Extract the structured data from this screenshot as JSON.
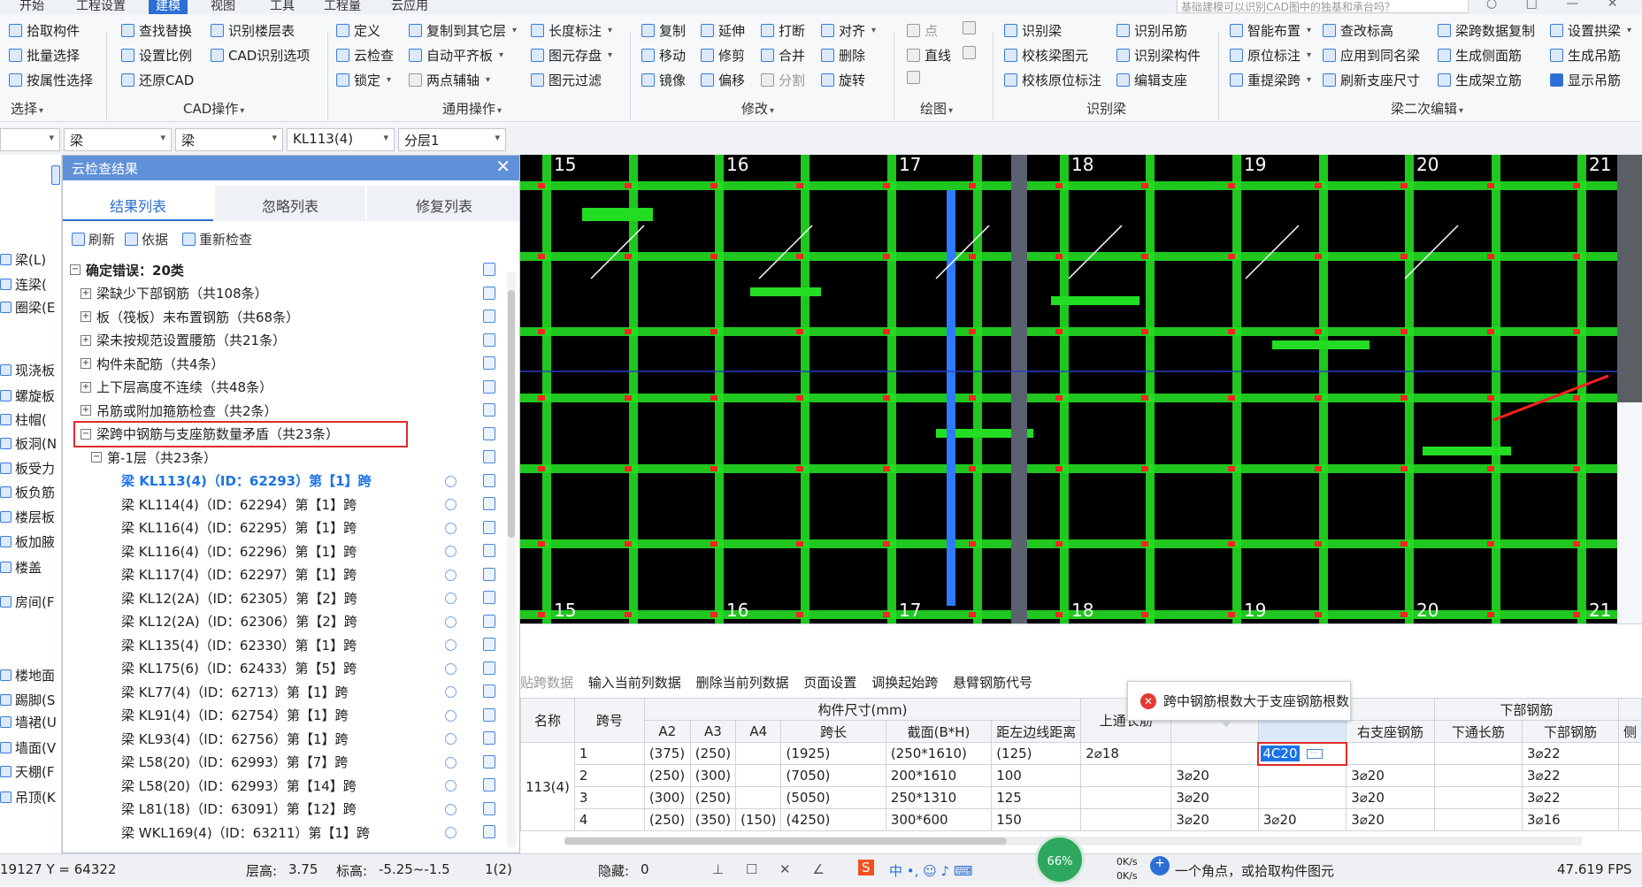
{
  "menubar": {
    "items": [
      "开始",
      "工程设置",
      "建模",
      "视图",
      "工具",
      "工程量",
      "云应用"
    ],
    "active_index": 2,
    "search_placeholder": "基础建模可以识别CAD图中的独基和承台吗？"
  },
  "ribbon": {
    "select": {
      "items": [
        "拾取构件",
        "批量选择",
        "按属性选择"
      ],
      "group": "选择"
    },
    "cad_ops": {
      "items": [
        "查找替换",
        "设置比例",
        "还原CAD",
        "识别楼层表",
        "CAD识别选项"
      ],
      "group": "CAD操作"
    },
    "common": {
      "items": [
        "定义",
        "云检查",
        "锁定",
        "复制到其它层",
        "自动平齐板",
        "两点辅轴",
        "长度标注",
        "图元存盘",
        "图元过滤"
      ],
      "group": "通用操作"
    },
    "modify": {
      "items": [
        "复制",
        "移动",
        "镜像",
        "延伸",
        "修剪",
        "偏移",
        "打断",
        "合并",
        "分割",
        "对齐",
        "删除",
        "旋转"
      ],
      "group": "修改"
    },
    "draw": {
      "items": [
        "点",
        "直线"
      ],
      "group": "绘图"
    },
    "identify_beam": {
      "items": [
        "识别梁",
        "校核梁图元",
        "校核原位标注",
        "识别吊筋",
        "识别梁构件",
        "编辑支座"
      ],
      "group": "识别梁"
    },
    "beam_edit": {
      "items": [
        "智能布置",
        "原位标注",
        "重提梁跨",
        "查改标高",
        "应用到同名梁",
        "刷新支座尺寸",
        "梁跨数据复制",
        "生成侧面筋",
        "生成架立筋",
        "设置拱梁",
        "生成吊筋",
        "显示吊筋"
      ],
      "group": "梁二次编辑"
    }
  },
  "selectors": [
    "",
    "梁",
    "梁",
    "KL113(4)",
    "分层1"
  ],
  "left_tree": [
    "梁(L)",
    "连梁(",
    "圈梁(E",
    "现浇板",
    "螺旋板",
    "柱帽(",
    "板洞(N",
    "板受力",
    "板负筋",
    "楼层板",
    "板加腋",
    "楼盖",
    "房间(F",
    "楼地面",
    "踢脚(S",
    "墙裙(U",
    "墙面(V",
    "天棚(F",
    "吊顶(K"
  ],
  "panel": {
    "title": "云检查结果",
    "tabs": [
      "结果列表",
      "忽略列表",
      "修复列表"
    ],
    "toolbar": [
      "刷新",
      "依据",
      "重新检查"
    ],
    "root": "确定错误：20类",
    "categories": [
      "梁缺少下部钢筋（共108条）",
      "板（筏板）未布置钢筋（共68条）",
      "梁未按规范设置腰筋（共21条）",
      "构件未配筋（共4条）",
      "上下层高度不连续（共48条）",
      "吊筋或附加箍筋检查（共2条）",
      "梁跨中钢筋与支座筋数量矛盾（共23条）"
    ],
    "sub_group": "第-1层（共23条）",
    "items": [
      "梁 KL113(4)（ID：62293）第【1】跨",
      "梁 KL114(4)（ID：62294）第【1】跨",
      "梁 KL116(4)（ID：62295）第【1】跨",
      "梁 KL116(4)（ID：62296）第【1】跨",
      "梁 KL117(4)（ID：62297）第【1】跨",
      "梁 KL12(2A)（ID：62305）第【2】跨",
      "梁 KL12(2A)（ID：62306）第【2】跨",
      "梁 KL135(4)（ID：62330）第【1】跨",
      "梁 KL175(6)（ID：62433）第【5】跨",
      "梁 KL77(4)（ID：62713）第【1】跨",
      "梁 KL91(4)（ID：62754）第【1】跨",
      "梁 KL93(4)（ID：62756）第【1】跨",
      "梁 L58(20)（ID：62993）第【7】跨",
      "梁 L58(20)（ID：62993）第【14】跨",
      "梁 L81(18)（ID：63091）第【12】跨",
      "梁 WKL169(4)（ID：63211）第【1】跨"
    ]
  },
  "cad": {
    "axis_labels": [
      "15",
      "16",
      "17",
      "18",
      "19",
      "20",
      "21"
    ],
    "colors": {
      "beam": "#22dd22",
      "background": "#000000",
      "marker": "#ff2222",
      "selected": "#2f7bff"
    }
  },
  "table": {
    "toolbar": [
      "贴跨数据",
      "输入当前列数据",
      "删除当前列数据",
      "页面设置",
      "调换起始跨",
      "悬臂钢筋代号"
    ],
    "header_groups": [
      "名称",
      "跨号",
      "构件尺寸(mm)",
      "上通长筋",
      "",
      "",
      "下部钢筋"
    ],
    "sub_headers": [
      "A2",
      "A3",
      "A4",
      "跨长",
      "截面(B*H)",
      "距左边线距离",
      "",
      "右支座钢筋",
      "下通长筋",
      "下部钢筋",
      "侧"
    ],
    "name": "113(4)",
    "rows": [
      {
        "span": "1",
        "a2": "(375)",
        "a3": "(250)",
        "a4": "",
        "len": "(1925)",
        "sec": "(250*1610)",
        "dist": "(125)",
        "top": "2⌀18",
        "left": "",
        "mid": "4C20",
        "right": "",
        "bot_through": "",
        "bot": "3⌀22"
      },
      {
        "span": "2",
        "a2": "(250)",
        "a3": "(300)",
        "a4": "",
        "len": "(7050)",
        "sec": "200*1610",
        "dist": "100",
        "top": "",
        "left": "3⌀20",
        "mid": "",
        "right": "3⌀20",
        "bot_through": "",
        "bot": "3⌀22"
      },
      {
        "span": "3",
        "a2": "(300)",
        "a3": "(250)",
        "a4": "",
        "len": "(5050)",
        "sec": "250*1310",
        "dist": "125",
        "top": "",
        "left": "3⌀20",
        "mid": "",
        "right": "3⌀20",
        "bot_through": "",
        "bot": "3⌀22"
      },
      {
        "span": "4",
        "a2": "(250)",
        "a3": "(350)",
        "a4": "(150)",
        "len": "(4250)",
        "sec": "300*600",
        "dist": "150",
        "top": "",
        "left": "3⌀20",
        "mid": "3⌀20",
        "right": "3⌀20",
        "bot_through": "",
        "bot": "3⌀16"
      }
    ],
    "tooltip": "跨中钢筋根数大于支座钢筋根数"
  },
  "status": {
    "coord": "19127 Y = 64322",
    "floor_height_label": "层高:",
    "floor_height": "3.75",
    "elev_label": "标高:",
    "elev": "-5.25~-1.5",
    "page": "1(2)",
    "hidden_label": "隐藏:",
    "hidden": "0",
    "cpu": "66%",
    "net_up": "0K/s",
    "net_down": "0K/s",
    "hint": "一个角点，或拾取构件图元",
    "fps": "47.619 FPS"
  }
}
